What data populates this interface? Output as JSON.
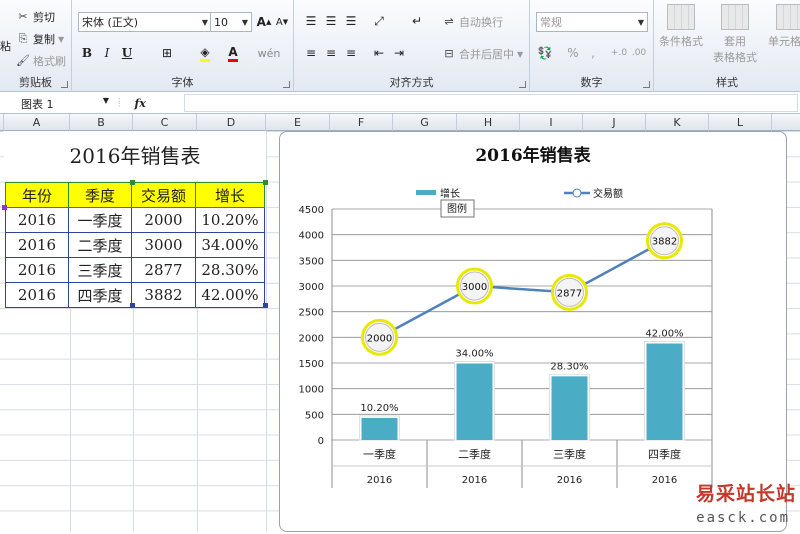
{
  "ribbon": {
    "clipboard": {
      "cut": "剪切",
      "copy": "复制",
      "format_painter": "格式刷",
      "paste_fragment": "粘",
      "group_label": "剪贴板"
    },
    "font": {
      "font_name": "宋体 (正文)",
      "font_size": "10",
      "bold": "B",
      "italic": "I",
      "underline": "U",
      "increase": "A",
      "decrease": "A",
      "phonetic": "wén",
      "font_color_letter": "A",
      "group_label": "字体"
    },
    "alignment": {
      "wrap_text": "自动换行",
      "merge_center": "合并后居中",
      "group_label": "对齐方式"
    },
    "number": {
      "format": "常规",
      "percent": "%",
      "comma": ",",
      "group_label": "数字"
    },
    "styles": {
      "conditional": "条件格式",
      "table_format_1": "套用",
      "table_format_2": "表格格式",
      "cell_styles": "单元格样",
      "group_label": "样式"
    }
  },
  "formula_bar": {
    "name_box": "图表 1",
    "fx": "fx",
    "value": ""
  },
  "columns": [
    "A",
    "B",
    "C",
    "D",
    "E",
    "F",
    "G",
    "H",
    "I",
    "J",
    "K",
    "L"
  ],
  "sheet": {
    "title": "2016年销售表",
    "headers": [
      "年份",
      "季度",
      "交易额",
      "增长"
    ],
    "rows": [
      [
        "2016",
        "一季度",
        "2000",
        "10.20%"
      ],
      [
        "2016",
        "二季度",
        "3000",
        "34.00%"
      ],
      [
        "2016",
        "三季度",
        "2877",
        "28.30%"
      ],
      [
        "2016",
        "四季度",
        "3882",
        "42.00%"
      ]
    ]
  },
  "chart_data": {
    "type": "bar",
    "title": "2016年销售表",
    "categories": [
      "一季度",
      "二季度",
      "三季度",
      "四季度"
    ],
    "category_group": [
      "2016",
      "2016",
      "2016",
      "2016"
    ],
    "ylim": [
      0,
      4500
    ],
    "yticks": [
      0,
      500,
      1000,
      1500,
      2000,
      2500,
      3000,
      3500,
      4000,
      4500
    ],
    "series": [
      {
        "name": "增长",
        "kind": "bar",
        "values": [
          430,
          1490,
          1240,
          1880
        ],
        "labels": [
          "10.20%",
          "34.00%",
          "28.30%",
          "42.00%"
        ],
        "color": "#4bacc6"
      },
      {
        "name": "交易额",
        "kind": "line",
        "values": [
          2000,
          3000,
          2877,
          3882
        ],
        "labels": [
          "2000",
          "3000",
          "2877",
          "3882"
        ],
        "color": "#4f81bd"
      }
    ],
    "legend_position": "top",
    "tooltip": "图例",
    "grid": true
  },
  "watermark": {
    "text": "易采站长站",
    "url": "easck.com"
  }
}
